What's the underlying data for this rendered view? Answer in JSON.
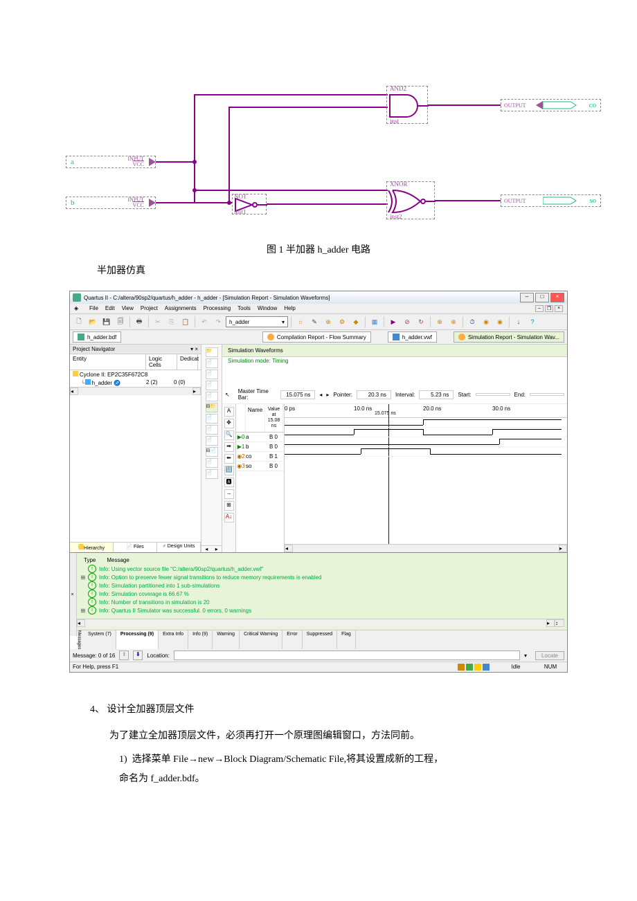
{
  "circuit": {
    "inputs": [
      {
        "name": "a",
        "pin": "INPUT",
        "vcc": "VCC"
      },
      {
        "name": "b",
        "pin": "INPUT",
        "vcc": "VCC"
      }
    ],
    "gates": [
      {
        "type": "AND2",
        "inst": "inst"
      },
      {
        "type": "NOT",
        "inst": "inst1"
      },
      {
        "type": "XNOR",
        "inst": "inst2"
      }
    ],
    "outputs": [
      {
        "pin": "OUTPUT",
        "name": "co"
      },
      {
        "pin": "OUTPUT",
        "name": "so"
      }
    ]
  },
  "caption": "图 1  半加器 h_adder 电路",
  "section_title": "半加器仿真",
  "quartus": {
    "title": "Quartus II - C:/altera/90sp2/quartus/h_adder - h_adder - [Simulation Report - Simulation Waveforms]",
    "menu": [
      "File",
      "Edit",
      "View",
      "Project",
      "Assignments",
      "Processing",
      "Tools",
      "Window",
      "Help"
    ],
    "combo_project": "h_adder",
    "doc_tabs": [
      {
        "label": "h_adder.bdf",
        "icon": "bdf"
      },
      {
        "label": "Compilation Report - Flow Summary",
        "icon": "report"
      },
      {
        "label": "h_adder.vwf",
        "icon": "vwf"
      },
      {
        "label": "Simulation Report - Simulation Wav...",
        "icon": "report",
        "active": true
      }
    ],
    "project_nav": {
      "title": "Project Navigator",
      "headers": [
        "Entity",
        "Logic Cells",
        "Dedicat"
      ],
      "rows": [
        {
          "c1": "Cyclone II: EP2C35F672C8",
          "c2": "",
          "c3": "",
          "icon": "chip"
        },
        {
          "c1": "h_adder",
          "c2": "2 (2)",
          "c3": "0 (0)",
          "icon": "dev",
          "indent": 1
        }
      ],
      "tabs": [
        "Hierarchy",
        "Files",
        "Design Units"
      ]
    },
    "sim": {
      "header": "Simulation Waveforms",
      "mode": "Simulation mode: Timing",
      "timebar": {
        "master_label": "Master Time Bar:",
        "master_val": "15.075 ns",
        "pointer_label": "Pointer:",
        "pointer_val": "20.3 ns",
        "interval_label": "Interval:",
        "interval_val": "5.23 ns",
        "start_label": "Start:",
        "start_val": "",
        "end_label": "End:",
        "end_val": ""
      },
      "name_col": "Name",
      "value_col": "Value at\n15.08 ns",
      "ruler": [
        "0 ps",
        "10.0 ns",
        "20.0 ns",
        "30.0 ns"
      ],
      "ruler_marker": "15.075 ns",
      "signals": [
        {
          "idx": "0",
          "name": "a",
          "val": "B 0",
          "type": "in"
        },
        {
          "idx": "1",
          "name": "b",
          "val": "B 0",
          "type": "in"
        },
        {
          "idx": "2",
          "name": "co",
          "val": "B 1",
          "type": "out"
        },
        {
          "idx": "3",
          "name": "so",
          "val": "B 0",
          "type": "out"
        }
      ]
    },
    "messages": {
      "headers": [
        "Type",
        "Message"
      ],
      "rows": [
        "Info: Using vector source file \"C:/altera/90sp2/quartus/h_adder.vwf\"",
        "Info: Option to preserve fewer signal transitions to reduce memory requirements is enabled",
        "Info: Simulation partitioned into 1 sub-simulations",
        "Info: Simulation coverage is      66.67 %",
        "Info: Number of transitions in simulation is 20",
        "Info: Quartus II Simulator was successful. 0 errors, 0 warnings"
      ],
      "tabs": [
        "System (7)",
        "Processing (9)",
        "Extra Info",
        "Info (9)",
        "Warning",
        "Critical Warning",
        "Error",
        "Suppressed",
        "Flag"
      ],
      "counter": "Message: 0 of 16",
      "location_label": "Location:",
      "locate_btn": "Locate"
    },
    "status": {
      "left": "For Help, press F1",
      "state": "Idle",
      "num": "NUM"
    }
  },
  "body": {
    "step_num": "4、",
    "step_title": "设计全加器顶层文件",
    "para1": "为了建立全加器顶层文件，必须再打开一个原理图编辑窗口，方法同前。",
    "item1_num": "1)",
    "item1_text": "选择菜单 File→new→Block Diagram/Schematic File,将其设置成新的工程，",
    "item1_cont": "命名为 f_adder.bdf。"
  }
}
